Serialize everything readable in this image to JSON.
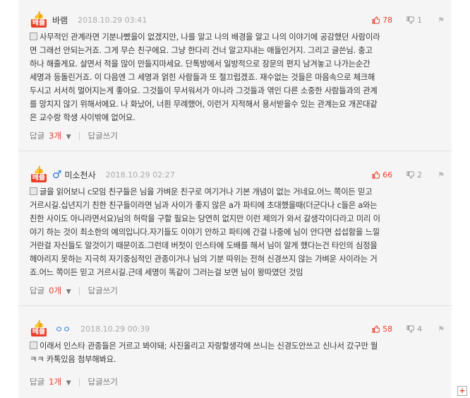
{
  "best_label": "베플",
  "comments": [
    {
      "nick": "바램",
      "date": "2018.10.29 03:41",
      "up": "78",
      "down": "1",
      "lines": [
        "사무적인 관계라면 기분나빴을이 없겠지만, 나를 알고 나의 배경을 알고 나의 이야기에 공감했던 사람이라",
        "면 그래선 안되는거죠. 그게 무슨 친구에요. 그냥 한다리 건너 알고지내는 애들인거지. 그리고 글쓴님. 충고",
        "하나 해줄게요. 살면서 적을 많이 만들지마세요. 단톡방에서 일방적으로 장문의 편지 남겨놓고 나가는순간",
        "세명과 등돌린거죠. 이 다음엔 그 세명과 얽힌 사람들과 또 절끄럽겠죠. 재수없는 것들은 마음속으로 체크해",
        "두시고 서서히 멀어지는게 좋아요. 그것들이 무서워서가 아니라 그것들과 엮인 다른 소중한 사람들과의 관계",
        "를 망치지 않기 위해서에요. 나 화났어, 너흰 무례했어, 이런거 지적해서 용서받을수 있는 관계는요 개꼰대같",
        "은 교수랑 학생 사이밖에 없어요."
      ],
      "reply_label": "답글",
      "reply_count": "3개",
      "write_label": "답글쓰기"
    },
    {
      "nick": "미소천사",
      "date": "2018.10.29 02:27",
      "up": "66",
      "down": "2",
      "lines": [
        "글을 읽어보니 c모임 친구들은 님을 가벼운 친구로 여기거나 기본 개념이 없는 거네요.어느 쪽이든 믿고",
        "거르시길.십년지기 친한 친구들이라면 님과 사이가 좋지 않은 a가 파티에 초대했을때(더군다나 c들은 a와는",
        "친한 사이도 아니라면서요)님의 허락을 구할 필요는 당연히 없지만 이런 제의가 와서 갈생각이다라고 미리 이",
        "야기 하는 것이 최소한의 예의입니다.자기들도 이야기 안하고 파티에 간걸 나중에 님이 안다면 섭섭함을 느낄",
        "거란걸 자신들도 알것이기 때문이죠.그런데 버젓이 인스타에 도배를 해서 님이 알게 했다는건 타인의 심정을",
        "헤아리지 못하는 지극히 자기중심적인 관종이거나 님의 기분 따위는 전혀 신경쓰지 않는 가벼운 사이라는 거",
        "죠.어느 쪽이든 믿고 거르시길.근데 세명이 똑같이 그러는걸 보면 님이 왕따였던 것임"
      ],
      "reply_label": "답글",
      "reply_count": "0개",
      "write_label": "답글쓰기"
    },
    {
      "nick": "ㅇㅇ",
      "date": "2018.10.29 00:39",
      "up": "58",
      "down": "4",
      "lines": [
        "이래서 인스타 관종들은 거르고 봐야돼; 사진올리고 자랑할생각에 쓰니는 신경도안쓰고 신나서 갔구만 뭘",
        "ㅋㅋ 카톡있음 첨부해봐요."
      ],
      "reply_label": "답글",
      "reply_count": "1개",
      "write_label": "답글쓰기"
    }
  ]
}
